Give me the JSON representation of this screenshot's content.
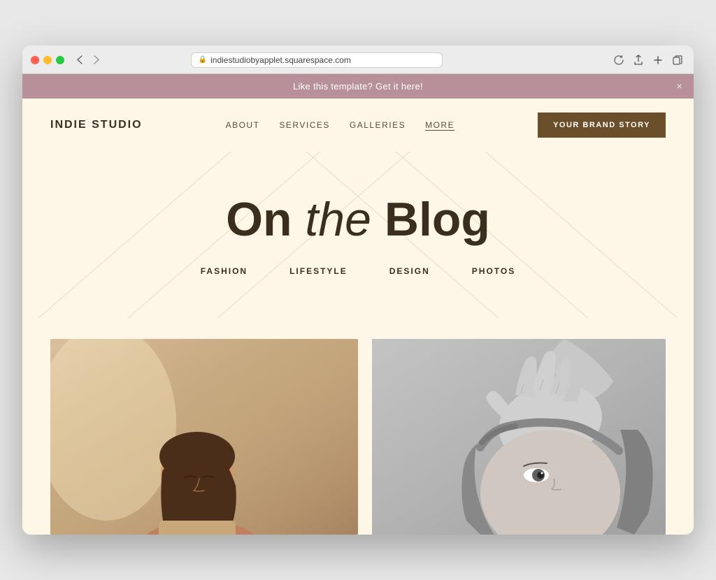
{
  "browser": {
    "url": "indiestudiobyapplet.squarespace.com",
    "reload_label": "↻"
  },
  "announcement": {
    "text": "Like this template? Get it here!",
    "close_label": "×"
  },
  "nav": {
    "logo": "INDIE STUDIO",
    "links": [
      {
        "label": "ABOUT",
        "active": false
      },
      {
        "label": "SERVICES",
        "active": false
      },
      {
        "label": "GALLERIES",
        "active": false
      },
      {
        "label": "MORE",
        "active": true
      }
    ],
    "cta_label": "YOUR BRAND STORY"
  },
  "hero": {
    "title_part1": "On ",
    "title_italic": "the",
    "title_part2": " Blog"
  },
  "categories": [
    {
      "label": "FASHION"
    },
    {
      "label": "LIFESTYLE"
    },
    {
      "label": "DESIGN"
    },
    {
      "label": "PHOTOS"
    }
  ],
  "colors": {
    "bg": "#fef7e8",
    "text_dark": "#3a2e1e",
    "cta_bg": "#6b4f2a",
    "announcement_bg": "#b8909a",
    "line_color": "rgba(200, 180, 150, 0.4)"
  }
}
